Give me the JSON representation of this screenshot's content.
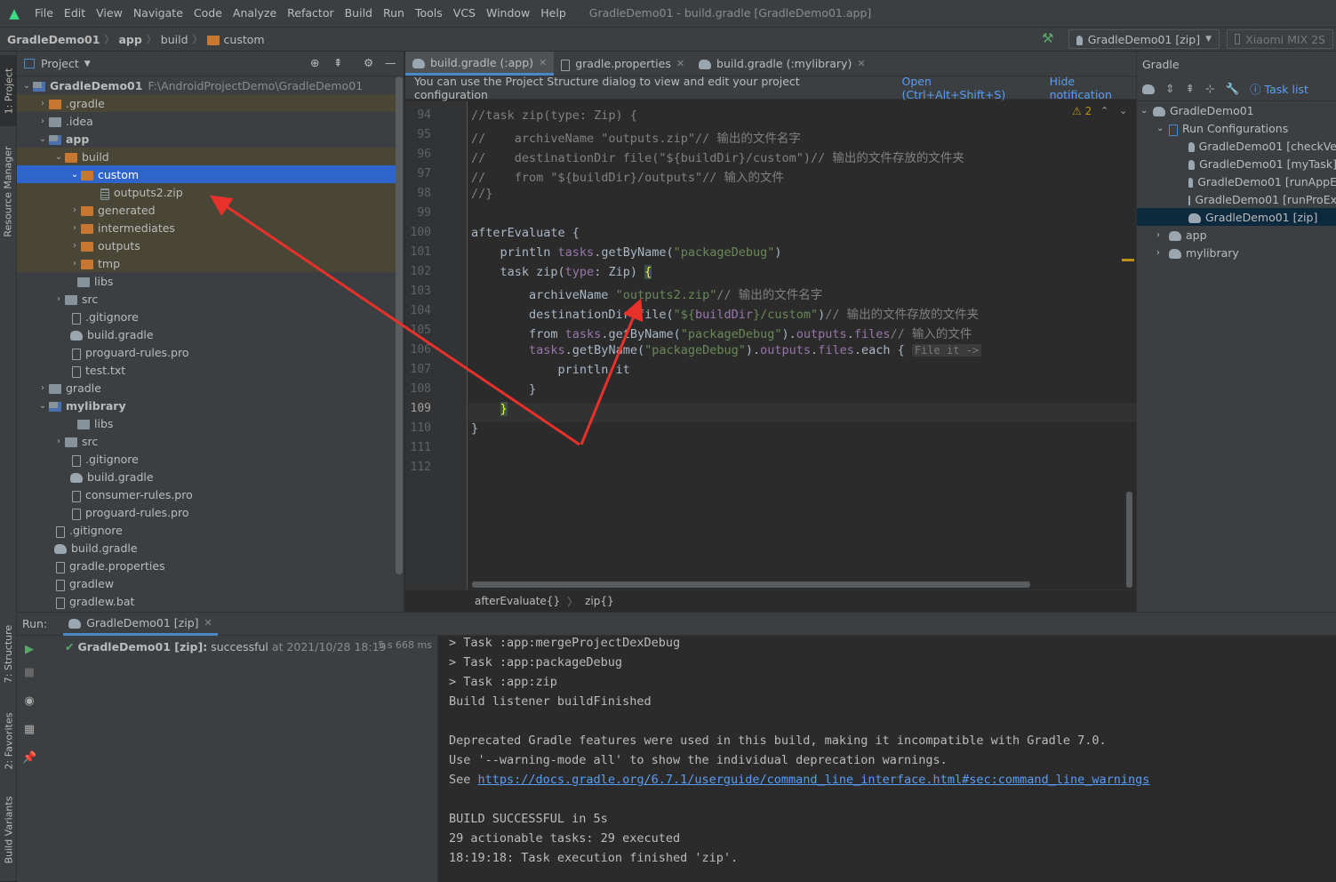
{
  "window_title": "GradleDemo01 - build.gradle [GradleDemo01.app]",
  "menu": [
    "File",
    "Edit",
    "View",
    "Navigate",
    "Code",
    "Analyze",
    "Refactor",
    "Build",
    "Run",
    "Tools",
    "VCS",
    "Window",
    "Help"
  ],
  "breadcrumb": {
    "project": "GradleDemo01",
    "module": "app",
    "dir1": "build",
    "dir2": "custom"
  },
  "toolbar": {
    "run_config": "GradleDemo01 [zip]",
    "device": "Xiaomi MIX 2S"
  },
  "left_tabs": {
    "project": "1: Project",
    "resource": "Resource Manager",
    "structure": "7: Structure",
    "favorites": "2: Favorites",
    "variants": "Build Variants"
  },
  "project_panel": {
    "title": "Project",
    "root_name": "GradleDemo01",
    "root_path": "F:\\AndroidProjectDemo\\GradleDemo01",
    "items": [
      ".gradle",
      ".idea",
      "app",
      "build",
      "custom",
      "outputs2.zip",
      "generated",
      "intermediates",
      "outputs",
      "tmp",
      "libs",
      "src",
      ".gitignore",
      "build.gradle",
      "proguard-rules.pro",
      "test.txt",
      "gradle",
      "mylibrary",
      "libs",
      "src",
      ".gitignore",
      "build.gradle",
      "consumer-rules.pro",
      "proguard-rules.pro",
      ".gitignore",
      "build.gradle",
      "gradle.properties",
      "gradlew",
      "gradlew.bat"
    ]
  },
  "editor": {
    "tabs": [
      "build.gradle (:app)",
      "gradle.properties",
      "build.gradle (:mylibrary)"
    ],
    "notification": "You can use the Project Structure dialog to view and edit your project configuration",
    "notif_open": "Open (Ctrl+Alt+Shift+S)",
    "notif_hide": "Hide notification",
    "warnings": "2",
    "line_numbers": [
      "94",
      "95",
      "96",
      "97",
      "98",
      "99",
      "100",
      "101",
      "102",
      "103",
      "104",
      "105",
      "106",
      "107",
      "108",
      "109",
      "110",
      "111",
      "112"
    ],
    "breadcrumbs": [
      "afterEvaluate{}",
      "zip{}"
    ]
  },
  "gradle_panel": {
    "title": "Gradle",
    "task_list": "Task list",
    "root": "GradleDemo01",
    "run_configs": "Run Configurations",
    "configs": [
      "GradleDemo01 [checkVe",
      "GradleDemo01 [myTask]",
      "GradleDemo01 [runAppE",
      "GradleDemo01 [runProEx",
      "GradleDemo01 [zip]"
    ],
    "modules": [
      "app",
      "mylibrary"
    ]
  },
  "run_panel": {
    "label": "Run:",
    "tab": "GradleDemo01 [zip]",
    "result_name": "GradleDemo01 [zip]:",
    "result_status": "successful",
    "result_time": "at 2021/10/28 18:19",
    "duration": "5 s 668 ms",
    "console": [
      "> Task :app:mergeProjectDexDebug",
      "> Task :app:packageDebug",
      "> Task :app:zip",
      "Build listener buildFinished",
      "",
      "Deprecated Gradle features were used in this build, making it incompatible with Gradle 7.0.",
      "Use '--warning-mode all' to show the individual deprecation warnings.",
      "",
      "",
      "BUILD SUCCESSFUL in 5s",
      "29 actionable tasks: 29 executed",
      "18:19:18: Task execution finished 'zip'."
    ],
    "see_prefix": "See ",
    "see_link": "https://docs.gradle.org/6.7.1/userguide/command_line_interface.html#sec:command_line_warnings"
  },
  "colors": {
    "accent": "#2f65ca",
    "arrow": "#e8312a",
    "link": "#589df6",
    "success": "#59a869"
  }
}
